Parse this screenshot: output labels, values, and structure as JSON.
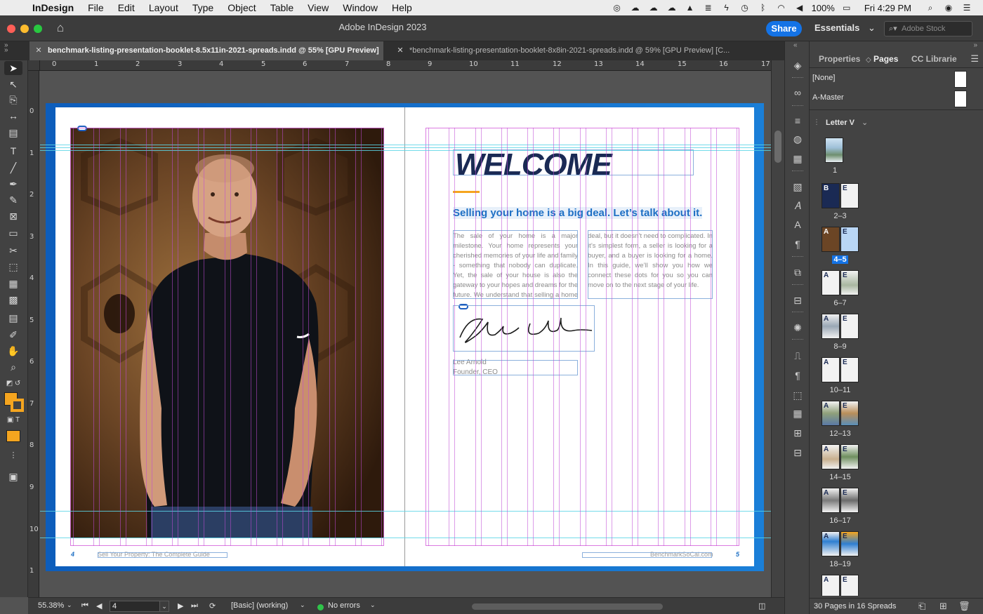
{
  "menubar": {
    "app": "InDesign",
    "items": [
      "File",
      "Edit",
      "Layout",
      "Type",
      "Object",
      "Table",
      "View",
      "Window",
      "Help"
    ],
    "battery": "100%",
    "clock": "Fri 4:29 PM"
  },
  "titlebar": {
    "title": "Adobe InDesign 2023",
    "share_label": "Share",
    "workspace": "Essentials",
    "stock_placeholder": "Adobe Stock"
  },
  "tabs": [
    {
      "label": "benchmark-listing-presentation-booklet-8.5x11in-2021-spreads.indd @ 55% [GPU Preview]",
      "active": true
    },
    {
      "label": "*benchmark-listing-presentation-booklet-8x8in-2021-spreads.indd @ 59% [GPU Preview] [C...",
      "active": false
    }
  ],
  "rulers": {
    "h_labels": [
      "0",
      "1",
      "2",
      "3",
      "4",
      "5",
      "6",
      "7",
      "8",
      "9",
      "10",
      "11",
      "12",
      "13",
      "14",
      "15",
      "16",
      "17"
    ],
    "v_labels": [
      "0",
      "1",
      "2",
      "3",
      "4",
      "5",
      "6",
      "7",
      "8",
      "9",
      "10",
      "1"
    ]
  },
  "document": {
    "welcome": "WELCOME",
    "subhead": "Selling your home is a big deal. Let’s talk about it.",
    "body_col1": "The sale of your home is a major milestone. Your home represents your cherished memories of your life and family - something that nobody can duplicate. Yet, the sale of your house is also the gateway to your hopes and dreams for the future. We understand that selling a home is a big",
    "body_col2": "deal, but it doesn’t need to complicated. In it’s simplest form, a seller is looking for a buyer, and a buyer is looking for a home. In this guide, we’ll show you how we connect these dots for you so you can move on to the next stage of your life.",
    "signature_name": "Lee Arnold",
    "signature_title": "Founder, CEO",
    "folio_left_num": "4",
    "folio_left_text": "Sell Your Property: The Complete Guide",
    "folio_right_text": "BenchmarkSoCal.com",
    "folio_right_num": "5"
  },
  "panel": {
    "tabs": [
      "Properties",
      "Pages",
      "CC Librarie"
    ],
    "active_tab": "Pages",
    "masters": [
      "[None]",
      "A-Master"
    ],
    "page_size": "Letter V",
    "spreads": [
      {
        "label": "1",
        "selected": false
      },
      {
        "label": "2–3",
        "selected": false
      },
      {
        "label": "4–5",
        "selected": true
      },
      {
        "label": "6–7",
        "selected": false
      },
      {
        "label": "8–9",
        "selected": false
      },
      {
        "label": "10–11",
        "selected": false
      },
      {
        "label": "12–13",
        "selected": false
      },
      {
        "label": "14–15",
        "selected": false
      },
      {
        "label": "16–17",
        "selected": false
      },
      {
        "label": "18–19",
        "selected": false
      },
      {
        "label": "",
        "selected": false
      }
    ],
    "footer": "30 Pages in 16 Spreads"
  },
  "statusbar": {
    "zoom": "55.38%",
    "page": "4",
    "style": "[Basic] (working)",
    "preflight": "No errors"
  },
  "colors": {
    "accent_blue": "#1473e6",
    "welcome_navy": "#1a2a54",
    "subhead_blue": "#1d6fc4",
    "orange": "#f5a51f",
    "guide_cyan": "#5bd5e6",
    "column_magenta": "#c04ad6"
  }
}
